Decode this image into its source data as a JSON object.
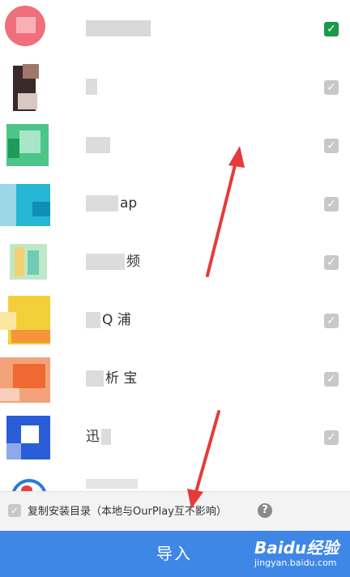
{
  "apps": [
    {
      "name": "",
      "checked": true,
      "tone": "red"
    },
    {
      "name": "",
      "checked": true,
      "tone": "dark"
    },
    {
      "name": "",
      "checked": true,
      "tone": "green"
    },
    {
      "name": "ap",
      "checked": true,
      "tone": "cyan"
    },
    {
      "name": "频",
      "checked": true,
      "tone": "mint"
    },
    {
      "name": "Q 浦",
      "checked": true,
      "tone": "yellow"
    },
    {
      "name": "析 宝",
      "checked": true,
      "tone": "orange"
    },
    {
      "name": "迅",
      "checked": true,
      "tone": "blue"
    }
  ],
  "option": {
    "label": "复制安装目录（本地与OurPlay互不影响）",
    "checked": true,
    "help": "?"
  },
  "import_button": {
    "label": "导入"
  },
  "watermark": {
    "logo": "Baidu经验",
    "url": "jingyan.baidu.com"
  },
  "colors": {
    "accent": "#3f87e6",
    "checked": "#1a9a4a",
    "arrow": "#e53b3b"
  }
}
